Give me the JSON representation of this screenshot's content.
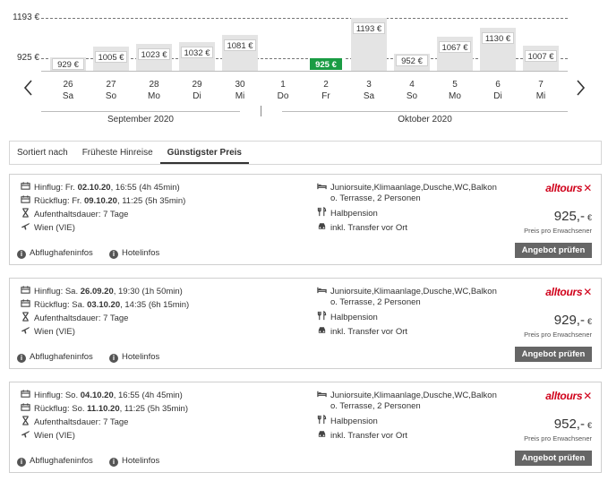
{
  "chart": {
    "ref_high": "1193 €",
    "ref_low": "925 €",
    "months": [
      "September 2020",
      "Oktober 2020"
    ],
    "days": [
      {
        "day": "26",
        "weekday": "Sa",
        "price": "929 €",
        "value": 929,
        "active": false
      },
      {
        "day": "27",
        "weekday": "So",
        "price": "1005 €",
        "value": 1005,
        "active": false
      },
      {
        "day": "28",
        "weekday": "Mo",
        "price": "1023 €",
        "value": 1023,
        "active": false
      },
      {
        "day": "29",
        "weekday": "Di",
        "price": "1032 €",
        "value": 1032,
        "active": false
      },
      {
        "day": "30",
        "weekday": "Mi",
        "price": "1081 €",
        "value": 1081,
        "active": false
      },
      {
        "day": "1",
        "weekday": "Do",
        "price": "",
        "value": null,
        "active": false
      },
      {
        "day": "2",
        "weekday": "Fr",
        "price": "925 €",
        "value": 925,
        "active": true
      },
      {
        "day": "3",
        "weekday": "Sa",
        "price": "1193 €",
        "value": 1193,
        "active": false
      },
      {
        "day": "4",
        "weekday": "So",
        "price": "952 €",
        "value": 952,
        "active": false
      },
      {
        "day": "5",
        "weekday": "Mo",
        "price": "1067 €",
        "value": 1067,
        "active": false
      },
      {
        "day": "6",
        "weekday": "Di",
        "price": "1130 €",
        "value": 1130,
        "active": false
      },
      {
        "day": "7",
        "weekday": "Mi",
        "price": "1007 €",
        "value": 1007,
        "active": false
      }
    ],
    "colors": {
      "bar": "#e4e4e4",
      "active": "#1a9c44"
    }
  },
  "sort": {
    "label": "Sortiert nach",
    "tabs": [
      "Früheste Hinreise",
      "Günstigster Preis"
    ],
    "active_tab": "Günstigster Preis"
  },
  "offers": [
    {
      "outbound_prefix": "Hinflug: Fr.",
      "outbound_date": "02.10.20",
      "outbound_rest": ", 16:55 (4h 45min)",
      "return_prefix": "Rückflug: Fr.",
      "return_date": "09.10.20",
      "return_rest": ", 11:25 (5h 35min)",
      "stay": "Aufenthaltsdauer: 7 Tage",
      "airport": "Wien (VIE)",
      "room_line1": "Juniorsuite,Klimaanlage,Dusche,WC,Balkon",
      "room_line2": "o. Terrasse, 2 Personen",
      "board": "Halbpension",
      "transfer": "inkl. Transfer vor Ort",
      "operator": "alltours",
      "price": "925,-",
      "currency": "€",
      "price_note": "Preis pro Erwachsener",
      "airport_info": "Abflughafeninfos",
      "hotel_info": "Hotelinfos",
      "button": "Angebot prüfen"
    },
    {
      "outbound_prefix": "Hinflug: Sa.",
      "outbound_date": "26.09.20",
      "outbound_rest": ", 19:30 (1h 50min)",
      "return_prefix": "Rückflug: Sa.",
      "return_date": "03.10.20",
      "return_rest": ", 14:35 (6h 15min)",
      "stay": "Aufenthaltsdauer: 7 Tage",
      "airport": "Wien (VIE)",
      "room_line1": "Juniorsuite,Klimaanlage,Dusche,WC,Balkon",
      "room_line2": "o. Terrasse, 2 Personen",
      "board": "Halbpension",
      "transfer": "inkl. Transfer vor Ort",
      "operator": "alltours",
      "price": "929,-",
      "currency": "€",
      "price_note": "Preis pro Erwachsener",
      "airport_info": "Abflughafeninfos",
      "hotel_info": "Hotelinfos",
      "button": "Angebot prüfen"
    },
    {
      "outbound_prefix": "Hinflug: So.",
      "outbound_date": "04.10.20",
      "outbound_rest": ", 16:55 (4h 45min)",
      "return_prefix": "Rückflug: So.",
      "return_date": "11.10.20",
      "return_rest": ", 11:25 (5h 35min)",
      "stay": "Aufenthaltsdauer: 7 Tage",
      "airport": "Wien (VIE)",
      "room_line1": "Juniorsuite,Klimaanlage,Dusche,WC,Balkon",
      "room_line2": "o. Terrasse, 2 Personen",
      "board": "Halbpension",
      "transfer": "inkl. Transfer vor Ort",
      "operator": "alltours",
      "price": "952,-",
      "currency": "€",
      "price_note": "Preis pro Erwachsener",
      "airport_info": "Abflughafeninfos",
      "hotel_info": "Hotelinfos",
      "button": "Angebot prüfen"
    }
  ]
}
